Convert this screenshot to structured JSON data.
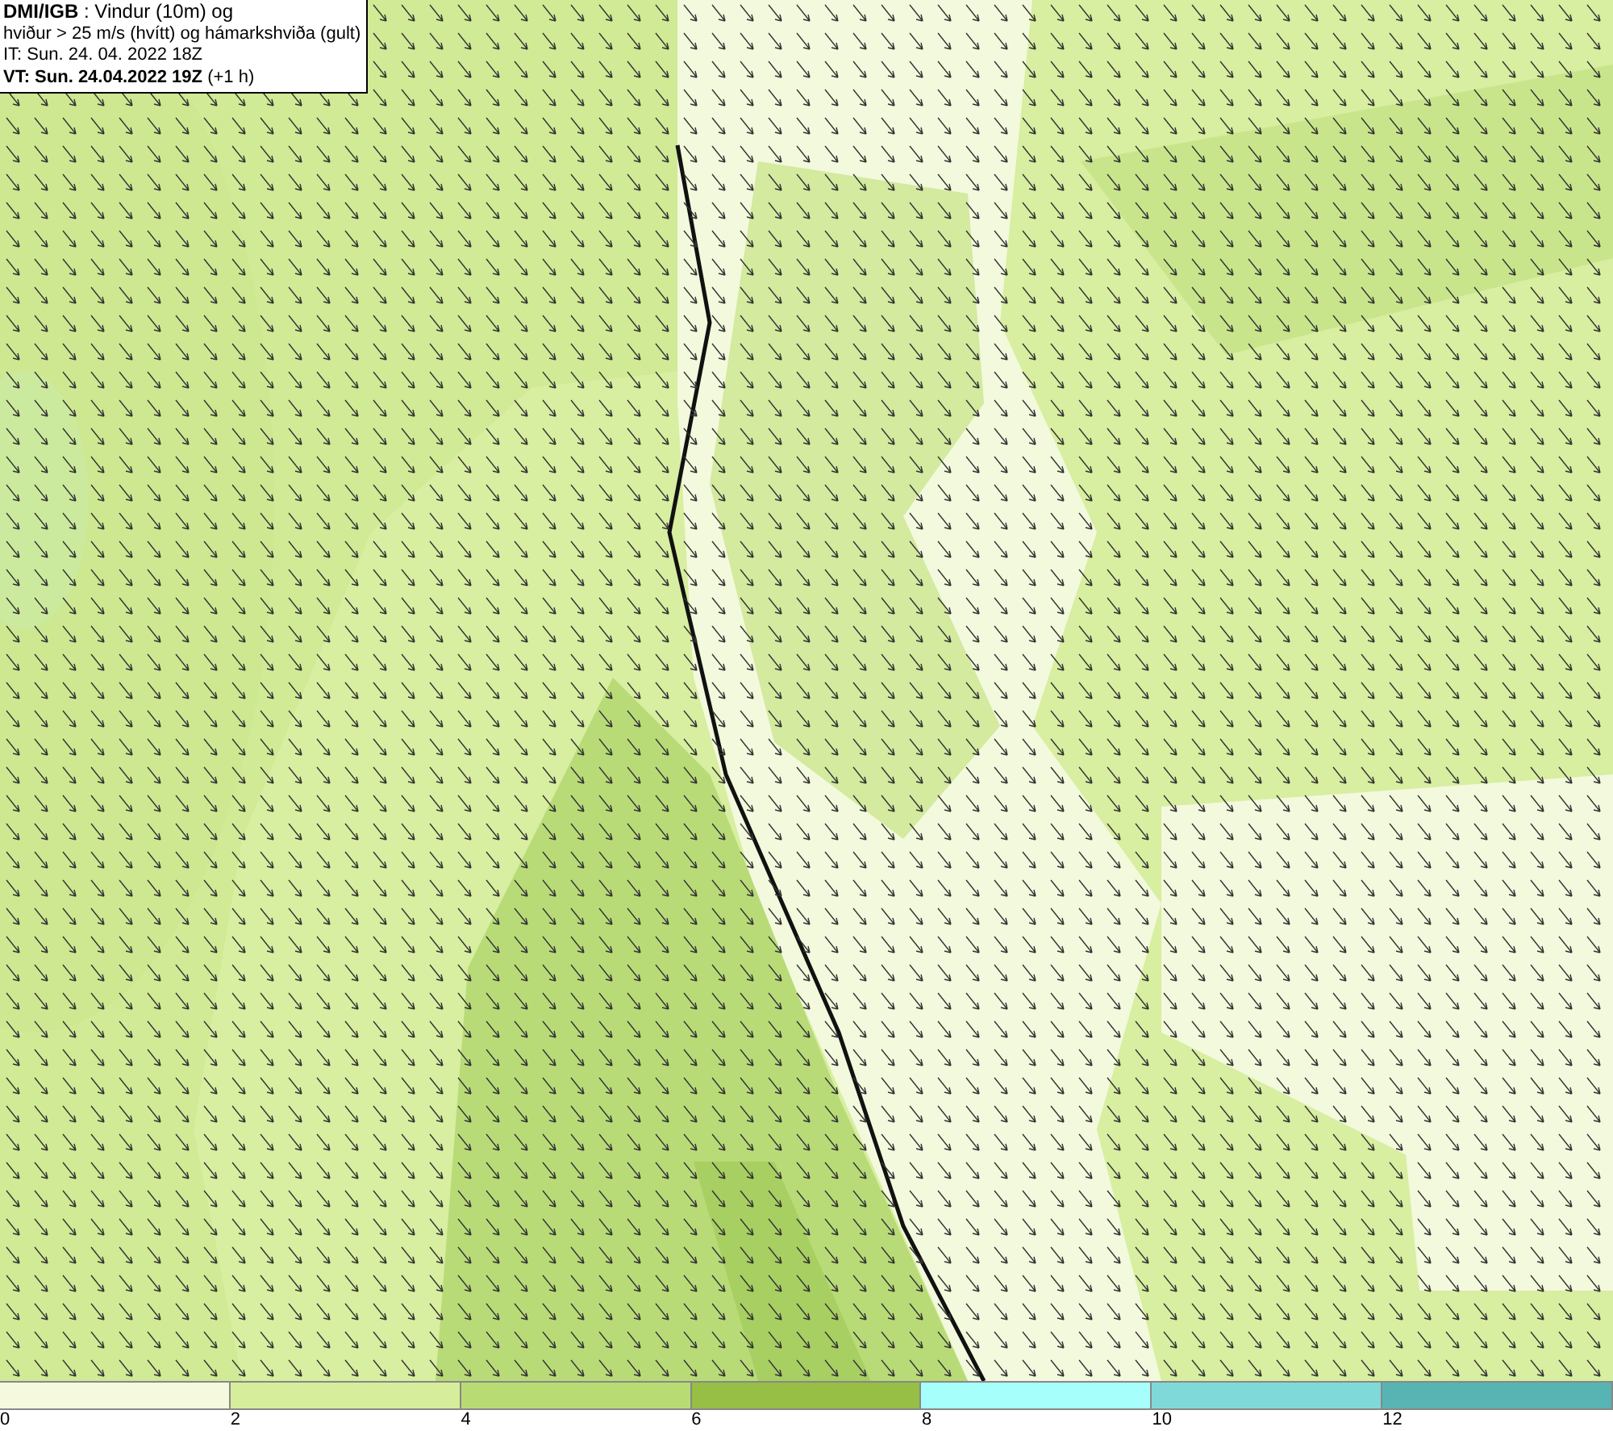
{
  "header": {
    "lines": [
      "**DMI/IGB** : Vindur (10m) og",
      "hviður > 25 m/s (hvítt) og hámarkshviða (gult)",
      "IT: Sun. 24. 04. 2022 18Z",
      "**VT: Sun. 24.04.2022 19Z** (+1 h)"
    ]
  },
  "legend": {
    "bins": [
      {
        "color": "#f5fadf"
      },
      {
        "color": "#d6ee9c"
      },
      {
        "color": "#b8db74"
      },
      {
        "color": "#97be45"
      },
      {
        "color": "#a6fffb"
      },
      {
        "color": "#80d9d9"
      },
      {
        "color": "#58b3b3"
      }
    ],
    "ticks": [
      "0",
      "2",
      "4",
      "6",
      "8",
      "10",
      "12"
    ]
  }
}
